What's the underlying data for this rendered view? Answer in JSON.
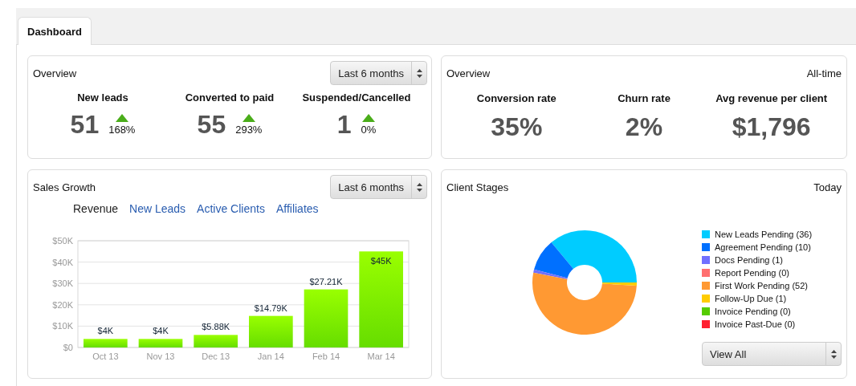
{
  "tabs": [
    {
      "label": "Dashboard",
      "selected": true
    }
  ],
  "overview": {
    "title": "Overview",
    "period": "Last 6 months",
    "metrics": [
      {
        "label": "New leads",
        "value": "51",
        "change": "168%"
      },
      {
        "label": "Converted to paid",
        "value": "55",
        "change": "293%"
      },
      {
        "label": "Suspended/Cancelled",
        "value": "1",
        "change": "0%"
      }
    ]
  },
  "overview_all_time": {
    "title": "Overview",
    "period": "All-time",
    "metrics": [
      {
        "label": "Conversion rate",
        "value": "35%"
      },
      {
        "label": "Churn rate",
        "value": "2%"
      },
      {
        "label": "Avg revenue per client",
        "value": "$1,796"
      }
    ]
  },
  "sales_growth": {
    "title": "Sales Growth",
    "period": "Last 6 months",
    "tabs": [
      {
        "label": "Revenue",
        "selected": true
      },
      {
        "label": "New Leads",
        "selected": false
      },
      {
        "label": "Active Clients",
        "selected": false
      },
      {
        "label": "Affiliates",
        "selected": false
      }
    ],
    "chart_data": {
      "type": "bar",
      "categories": [
        "Oct 13",
        "Nov 13",
        "Dec 13",
        "Jan 14",
        "Feb 14",
        "Mar 14"
      ],
      "values": [
        4000,
        4000,
        5880,
        14790,
        27210,
        45000
      ],
      "ylim": [
        0,
        50000
      ],
      "grid": true,
      "yticks": [
        {
          "value": 0,
          "label": "$0"
        },
        {
          "value": 10000,
          "label": "$10K"
        },
        {
          "value": 20000,
          "label": "$20K"
        },
        {
          "value": 30000,
          "label": "$30K"
        },
        {
          "value": 40000,
          "label": "$40K"
        },
        {
          "value": 50000,
          "label": "$50K"
        }
      ],
      "value_labels": [
        "$4K",
        "$4K",
        "$5.88K",
        "$14.79K",
        "$27.21K",
        "$45K"
      ]
    }
  },
  "client_stages": {
    "title": "Client Stages",
    "period": "Today",
    "legend": [
      {
        "color": "#00ccff"
      },
      {
        "color": "#0070ff"
      },
      {
        "color": "#7070ff"
      },
      {
        "color": "#ff6f6f"
      },
      {
        "color": "#ff9933"
      },
      {
        "color": "#ffcc00"
      },
      {
        "color": "#55cc00"
      },
      {
        "color": "#ff2030"
      }
    ],
    "chart_data": {
      "type": "donut",
      "categories": [
        "New Leads Pending (36)",
        "Agreement Pending (10)",
        "Docs Pending (1)",
        "Report Pending (0)",
        "First Work Pending (52)",
        "Follow-Up Due (1)",
        "Invoice Pending (0)",
        "Invoice Past-Due (0)"
      ],
      "values": [
        36,
        10,
        1,
        0,
        52,
        1,
        0,
        0
      ]
    },
    "filter": "View All"
  }
}
